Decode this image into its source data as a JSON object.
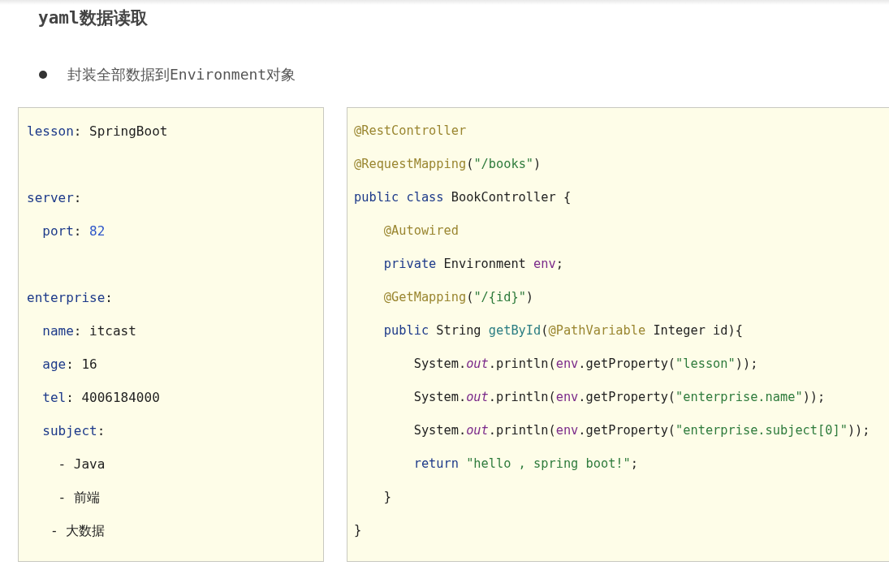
{
  "title": "yaml数据读取",
  "bullets": [
    "封装全部数据到Environment对象"
  ],
  "yaml_panel": {
    "lines": [
      {
        "kind": "code",
        "tokens": [
          {
            "kind": "key",
            "s": "lesson"
          },
          {
            "kind": "plain",
            "s": ": SpringBoot"
          }
        ]
      },
      {
        "kind": "blank"
      },
      {
        "kind": "code",
        "tokens": [
          {
            "kind": "key",
            "s": "server"
          },
          {
            "kind": "plain",
            "s": ":"
          }
        ]
      },
      {
        "kind": "code",
        "tokens": [
          {
            "kind": "key",
            "s": "  port"
          },
          {
            "kind": "plain",
            "s": ": "
          },
          {
            "kind": "number",
            "s": "82"
          }
        ]
      },
      {
        "kind": "blank"
      },
      {
        "kind": "code",
        "tokens": [
          {
            "kind": "key",
            "s": "enterprise"
          },
          {
            "kind": "plain",
            "s": ":"
          }
        ]
      },
      {
        "kind": "code",
        "tokens": [
          {
            "kind": "key",
            "s": "  name"
          },
          {
            "kind": "plain",
            "s": ": itcast"
          }
        ]
      },
      {
        "kind": "code",
        "tokens": [
          {
            "kind": "key",
            "s": "  age"
          },
          {
            "kind": "plain",
            "s": ": 16"
          }
        ]
      },
      {
        "kind": "code",
        "tokens": [
          {
            "kind": "key",
            "s": "  tel"
          },
          {
            "kind": "plain",
            "s": ": 4006184000"
          }
        ]
      },
      {
        "kind": "code",
        "tokens": [
          {
            "kind": "key",
            "s": "  subject"
          },
          {
            "kind": "plain",
            "s": ":"
          }
        ]
      },
      {
        "kind": "code",
        "tokens": [
          {
            "kind": "plain",
            "s": "    - Java"
          }
        ]
      },
      {
        "kind": "code",
        "tokens": [
          {
            "kind": "plain",
            "s": "    - 前端"
          }
        ]
      },
      {
        "kind": "code",
        "tokens": [
          {
            "kind": "plain",
            "s": "   - 大数据"
          }
        ]
      }
    ]
  },
  "java_panel": {
    "lines": [
      {
        "kind": "code",
        "tokens": [
          {
            "kind": "annotation",
            "s": "@RestController"
          }
        ]
      },
      {
        "kind": "code",
        "tokens": [
          {
            "kind": "annotation",
            "s": "@RequestMapping"
          },
          {
            "kind": "plain",
            "s": "("
          },
          {
            "kind": "string",
            "s": "\"/books\""
          },
          {
            "kind": "plain",
            "s": ")"
          }
        ]
      },
      {
        "kind": "code",
        "tokens": [
          {
            "kind": "keyword",
            "s": "public class "
          },
          {
            "kind": "plain",
            "s": "BookController {"
          }
        ]
      },
      {
        "kind": "code",
        "tokens": [
          {
            "kind": "annotation",
            "s": "    @Autowired"
          }
        ]
      },
      {
        "kind": "code",
        "tokens": [
          {
            "kind": "keyword",
            "s": "    private "
          },
          {
            "kind": "plain",
            "s": "Environment "
          },
          {
            "kind": "var",
            "s": "env"
          },
          {
            "kind": "plain",
            "s": ";"
          }
        ]
      },
      {
        "kind": "code",
        "tokens": [
          {
            "kind": "annotation",
            "s": "    @GetMapping"
          },
          {
            "kind": "plain",
            "s": "("
          },
          {
            "kind": "string",
            "s": "\"/{id}\""
          },
          {
            "kind": "plain",
            "s": ")"
          }
        ]
      },
      {
        "kind": "code",
        "tokens": [
          {
            "kind": "keyword",
            "s": "    public "
          },
          {
            "kind": "plain",
            "s": "String "
          },
          {
            "kind": "method",
            "s": "getById"
          },
          {
            "kind": "plain",
            "s": "("
          },
          {
            "kind": "annotation",
            "s": "@PathVariable "
          },
          {
            "kind": "plain",
            "s": "Integer id){"
          }
        ]
      },
      {
        "kind": "code",
        "tokens": [
          {
            "kind": "plain",
            "s": "        System."
          },
          {
            "kind": "field",
            "s": "out"
          },
          {
            "kind": "plain",
            "s": ".println("
          },
          {
            "kind": "var",
            "s": "env"
          },
          {
            "kind": "plain",
            "s": ".getProperty("
          },
          {
            "kind": "string",
            "s": "\"lesson\""
          },
          {
            "kind": "plain",
            "s": "));"
          }
        ]
      },
      {
        "kind": "code",
        "tokens": [
          {
            "kind": "plain",
            "s": "        System."
          },
          {
            "kind": "field",
            "s": "out"
          },
          {
            "kind": "plain",
            "s": ".println("
          },
          {
            "kind": "var",
            "s": "env"
          },
          {
            "kind": "plain",
            "s": ".getProperty("
          },
          {
            "kind": "string",
            "s": "\"enterprise.name\""
          },
          {
            "kind": "plain",
            "s": "));"
          }
        ]
      },
      {
        "kind": "code",
        "tokens": [
          {
            "kind": "plain",
            "s": "        System."
          },
          {
            "kind": "field",
            "s": "out"
          },
          {
            "kind": "plain",
            "s": ".println("
          },
          {
            "kind": "var",
            "s": "env"
          },
          {
            "kind": "plain",
            "s": ".getProperty("
          },
          {
            "kind": "string",
            "s": "\"enterprise.subject[0]\""
          },
          {
            "kind": "plain",
            "s": "));"
          }
        ]
      },
      {
        "kind": "code",
        "tokens": [
          {
            "kind": "keyword",
            "s": "        return "
          },
          {
            "kind": "string",
            "s": "\"hello , spring boot!\""
          },
          {
            "kind": "plain",
            "s": ";"
          }
        ]
      },
      {
        "kind": "code",
        "tokens": [
          {
            "kind": "plain",
            "s": "    }"
          }
        ]
      },
      {
        "kind": "code",
        "tokens": [
          {
            "kind": "plain",
            "s": "}"
          }
        ]
      }
    ]
  }
}
